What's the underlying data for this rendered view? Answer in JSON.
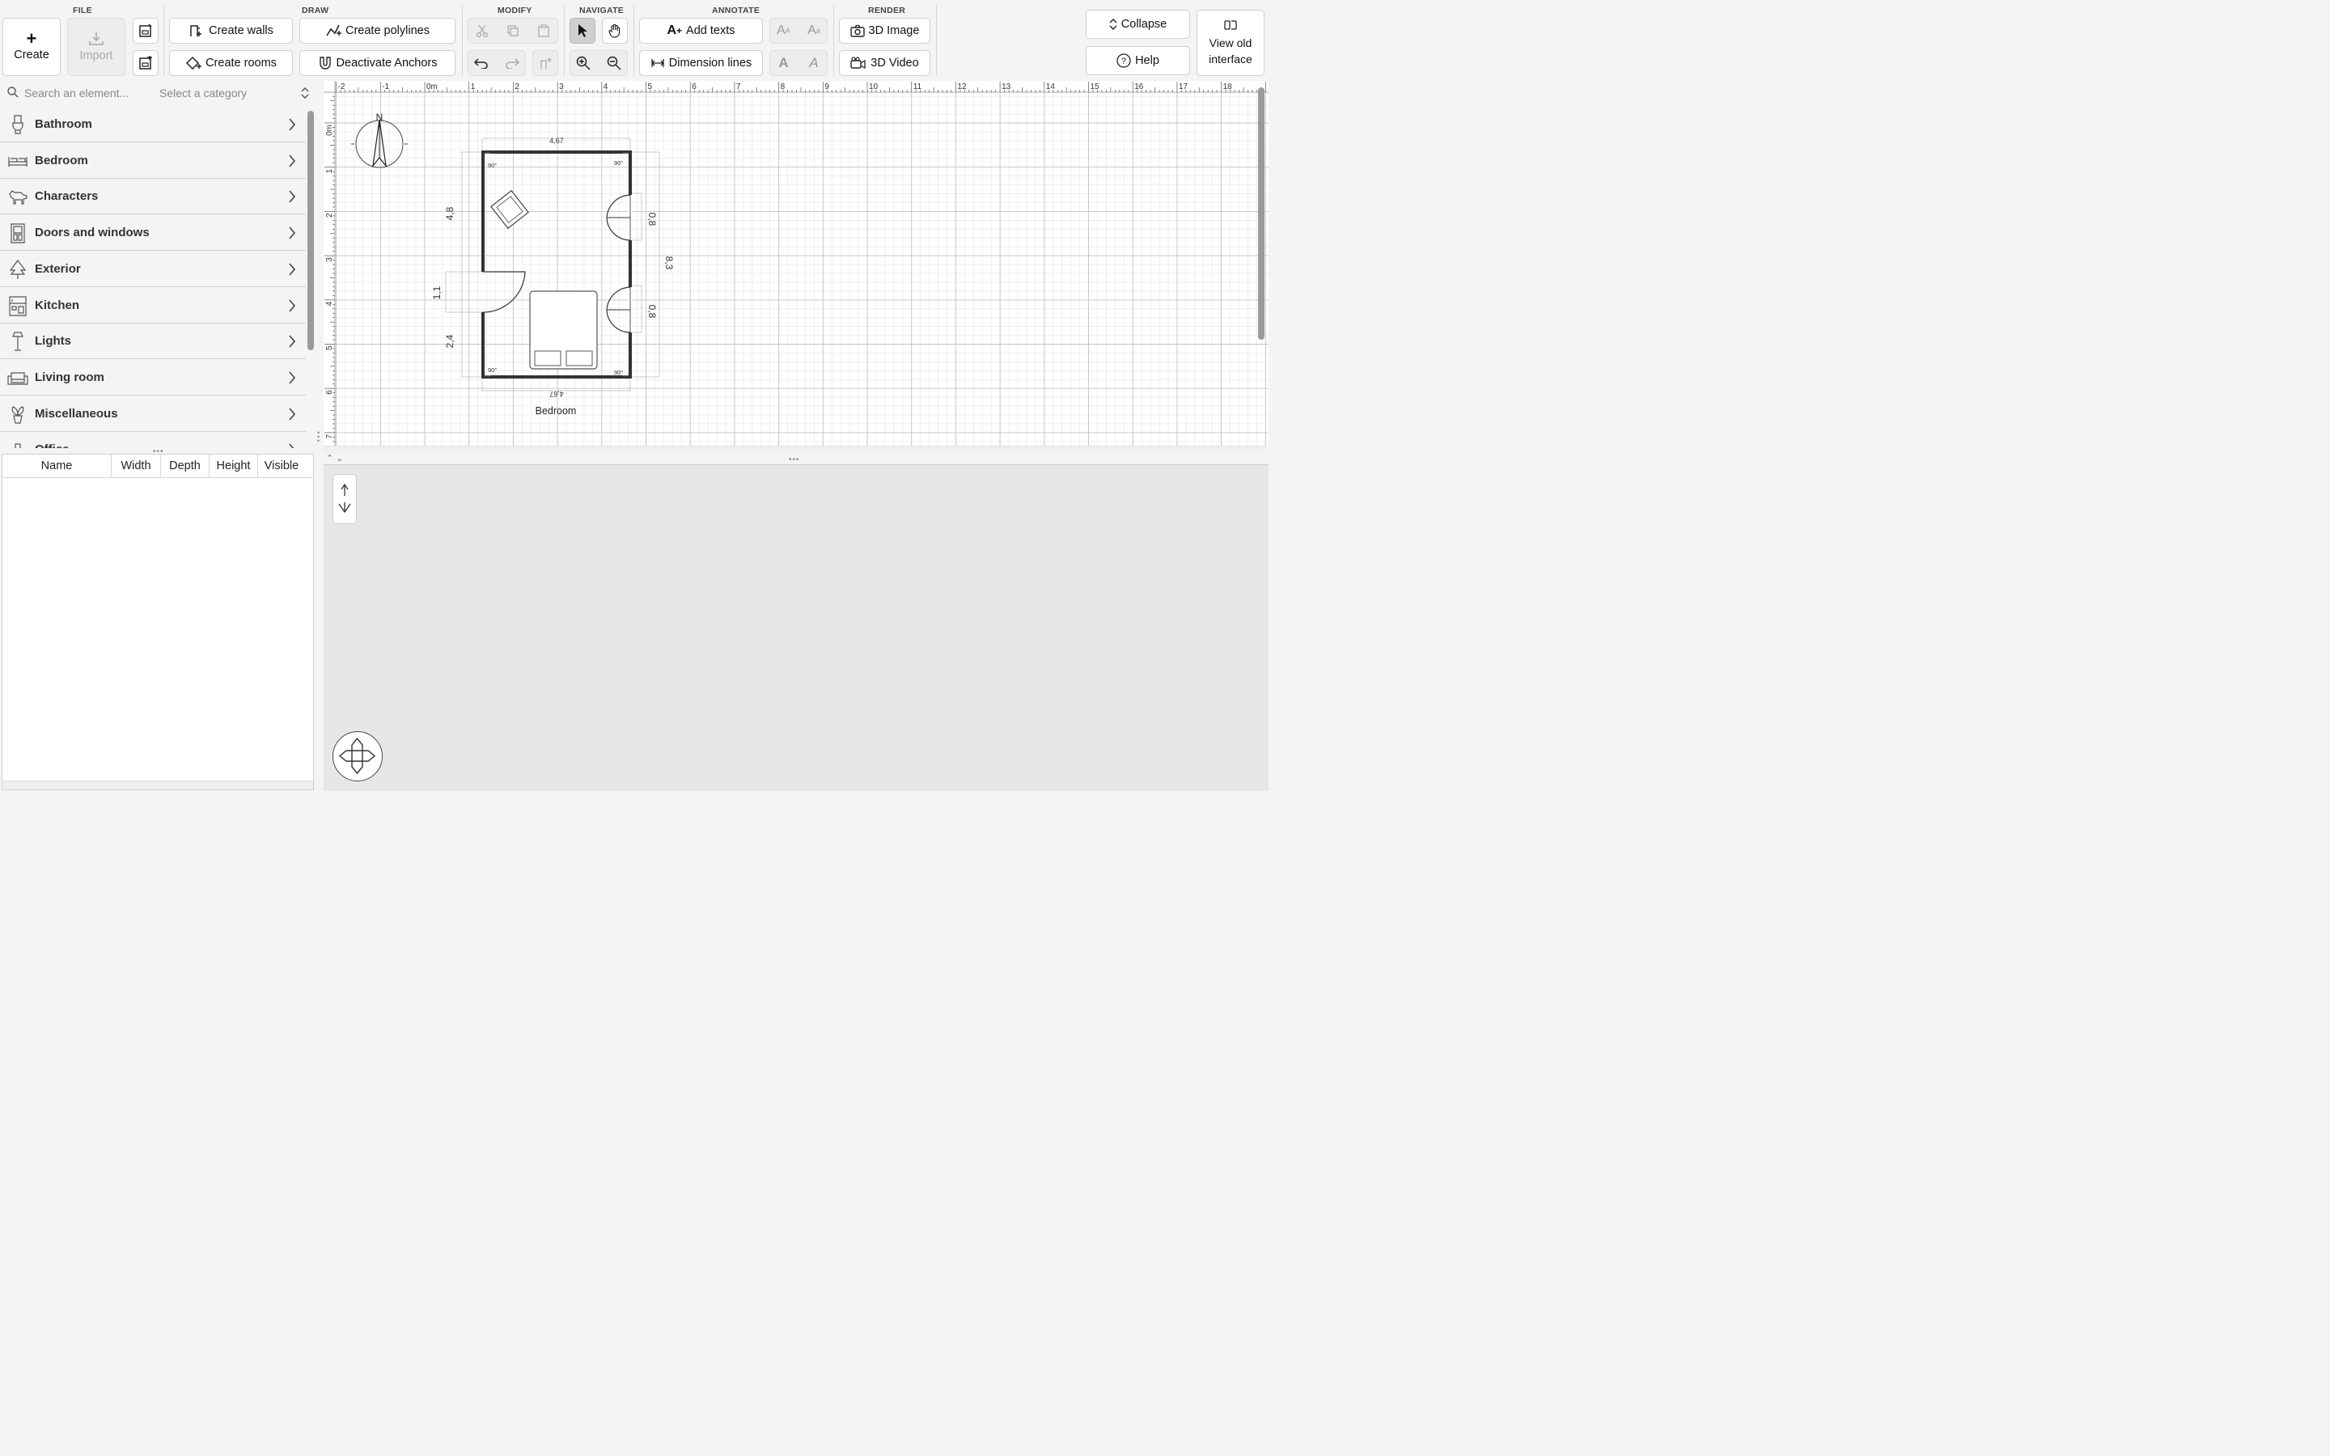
{
  "toolbar": {
    "groups": {
      "file": "FILE",
      "draw": "DRAW",
      "modify": "MODIFY",
      "navigate": "NAVIGATE",
      "annotate": "ANNOTATE",
      "render": "RENDER"
    },
    "create_label": "Create",
    "import_label": "Import",
    "create_walls_label": "Create walls",
    "create_polylines_label": "Create polylines",
    "create_rooms_label": "Create rooms",
    "deactivate_anchors_label": "Deactivate Anchors",
    "add_texts_label": "Add texts",
    "dimension_lines_label": "Dimension lines",
    "image_3d_label": "3D Image",
    "video_3d_label": "3D Video",
    "collapse_label": "Collapse",
    "help_label": "Help",
    "view_old_label_1": "View old",
    "view_old_label_2": "interface",
    "selected_tool": "select"
  },
  "search": {
    "placeholder": "Search an element...",
    "category_placeholder": "Select a category"
  },
  "categories": [
    {
      "label": "Bathroom",
      "icon": "toilet-icon"
    },
    {
      "label": "Bedroom",
      "icon": "bed-icon"
    },
    {
      "label": "Characters",
      "icon": "dog-icon"
    },
    {
      "label": "Doors and windows",
      "icon": "door-icon"
    },
    {
      "label": "Exterior",
      "icon": "tree-icon"
    },
    {
      "label": "Kitchen",
      "icon": "fridge-icon"
    },
    {
      "label": "Lights",
      "icon": "lamp-icon"
    },
    {
      "label": "Living room",
      "icon": "sofa-icon"
    },
    {
      "label": "Miscellaneous",
      "icon": "plant-icon"
    },
    {
      "label": "Office",
      "icon": "office-icon"
    }
  ],
  "table": {
    "columns": [
      "Name",
      "Width",
      "Depth",
      "Height",
      "Visible"
    ]
  },
  "plan": {
    "ruler_x": [
      "-2",
      "-1",
      "0m",
      "1",
      "2",
      "3",
      "4",
      "5",
      "6",
      "7",
      "8",
      "9",
      "10",
      "11",
      "12",
      "13",
      "14",
      "15",
      "16",
      "17",
      "18"
    ],
    "ruler_y": [
      "0m",
      "1",
      "2",
      "3",
      "4",
      "5",
      "6",
      "7"
    ],
    "compass_label": "N",
    "room_label": "Bedroom",
    "dimensions": {
      "top": "4,67",
      "bottom": "4,67",
      "left_upper": "4,8",
      "left_door": "1,1",
      "left_lower": "2,4",
      "right_total": "8,3",
      "right_win_1": "0,8",
      "right_win_2": "0,8"
    },
    "angles": [
      "90°",
      "90°",
      "90°",
      "90°"
    ]
  },
  "colors": {
    "accent": "#222222",
    "wall": "#333333",
    "grid": "#e4e4e4",
    "grid_major": "#bdbdbd"
  }
}
